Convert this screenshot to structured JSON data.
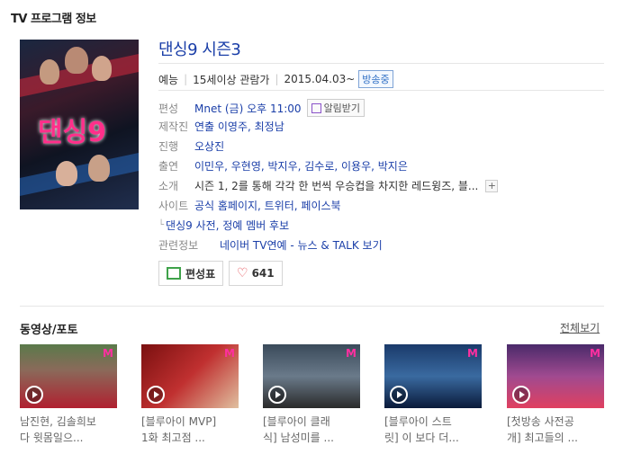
{
  "section_title": "TV 프로그램 정보",
  "program": {
    "title": "댄싱9 시즌3",
    "poster_text": "댄싱9",
    "genre": "예능",
    "rating": "15세이상 관람가",
    "start_date": "2015.04.03~",
    "onair_badge": "방송중",
    "alarm_label": "알림받기"
  },
  "details": [
    {
      "label": "편성",
      "value": "Mnet (금) 오후 11:00"
    },
    {
      "label": "제작진",
      "value": "연출 이영주, 최정남"
    },
    {
      "label": "진행",
      "value": "오상진"
    },
    {
      "label": "출연",
      "value": "이민우, 우현영, 박지우, 김수로, 이용우, 박지은"
    },
    {
      "label": "소개",
      "value": "시즌 1, 2를 통해 각각 한 번씩 우승컵을 차지한 레드윙즈, 블..."
    },
    {
      "label": "사이트",
      "value": "공식 홈페이지, 트위터, 페이스북"
    }
  ],
  "extra_link": "댄싱9 사전, 정예 멤버 후보",
  "related": {
    "label": "관련정보",
    "value": "네이버 TV연예 - 뉴스 & TALK 보기"
  },
  "buttons": {
    "schedule": "편성표",
    "likes": "641"
  },
  "media": {
    "title": "동영상/포토",
    "view_all": "전체보기",
    "items": [
      {
        "line1": "남진현, 김솔희보",
        "line2": "다 윗몸일으..."
      },
      {
        "line1": "[블루아이 MVP]",
        "line2": "1화 최고점 ..."
      },
      {
        "line1": "[블루아이 클래",
        "line2": "식] 남성미를 ..."
      },
      {
        "line1": "[블루아이 스트",
        "line2": "릿] 이 보다 더..."
      },
      {
        "line1": "[첫방송 사전공",
        "line2": "개] 최고들의 ..."
      }
    ]
  },
  "colors": {
    "link": "#1a3ea8",
    "accent_pink": "#ff2fa0",
    "onair": "#2f6fc4"
  }
}
